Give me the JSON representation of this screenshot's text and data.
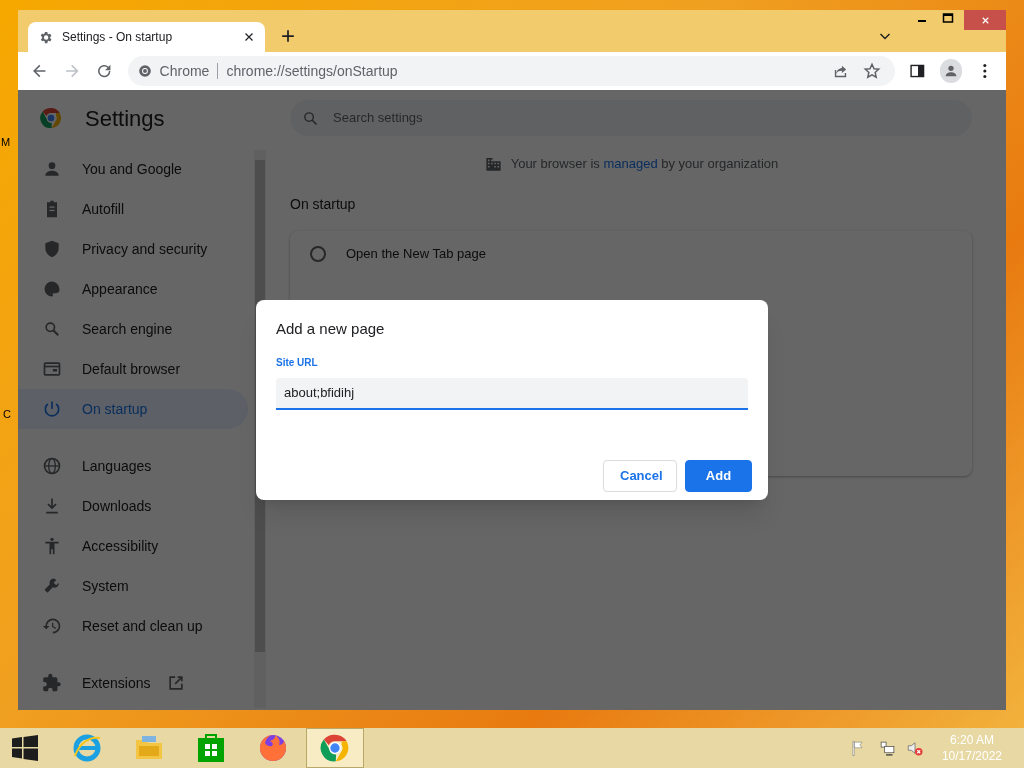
{
  "desktop": {
    "icon_labels": [
      "M",
      "C"
    ]
  },
  "window": {
    "tab_title": "Settings - On startup",
    "address": {
      "chip": "Chrome",
      "url": "chrome://settings/onStartup"
    }
  },
  "settings": {
    "title": "Settings",
    "search_placeholder": "Search settings",
    "nav_groups": [
      [
        {
          "label": "You and Google",
          "selected": false
        },
        {
          "label": "Autofill",
          "selected": false
        },
        {
          "label": "Privacy and security",
          "selected": false
        },
        {
          "label": "Appearance",
          "selected": false
        },
        {
          "label": "Search engine",
          "selected": false
        },
        {
          "label": "Default browser",
          "selected": false
        },
        {
          "label": "On startup",
          "selected": true
        }
      ],
      [
        {
          "label": "Languages",
          "selected": false
        },
        {
          "label": "Downloads",
          "selected": false
        },
        {
          "label": "Accessibility",
          "selected": false
        },
        {
          "label": "System",
          "selected": false
        },
        {
          "label": "Reset and clean up",
          "selected": false
        }
      ],
      [
        {
          "label": "Extensions",
          "selected": false,
          "external": true
        }
      ]
    ],
    "managed_notice": {
      "before": "Your browser is",
      "link": "managed",
      "after": "by your organization"
    },
    "section_title": "On startup",
    "options": [
      {
        "label": "Open the New Tab page",
        "selected": false
      }
    ]
  },
  "dialog": {
    "title": "Add a new page",
    "field_label": "Site URL",
    "value": "about;bfidihj",
    "buttons": [
      {
        "label": "Cancel",
        "kind": "secondary"
      },
      {
        "label": "Add",
        "kind": "primary"
      }
    ]
  },
  "taskbar": {
    "apps": [
      {
        "active": false
      },
      {
        "active": false
      },
      {
        "active": false
      },
      {
        "active": false
      },
      {
        "active": true
      }
    ],
    "time": "6:20 AM",
    "date": "10/17/2022"
  }
}
